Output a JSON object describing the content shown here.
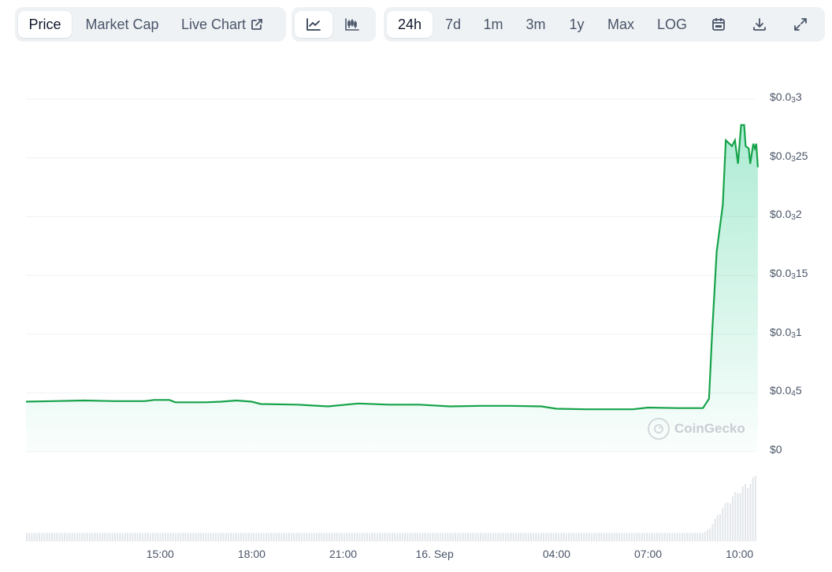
{
  "toolbar_left": {
    "price": "Price",
    "market_cap": "Market Cap",
    "live_chart": "Live Chart"
  },
  "toolbar_mid": {
    "line_icon": "line-chart-icon",
    "candle_icon": "candlestick-icon"
  },
  "toolbar_right": {
    "ranges": [
      "24h",
      "7d",
      "1m",
      "3m",
      "1y",
      "Max",
      "LOG"
    ],
    "selected": "24h",
    "icons": [
      "calendar-icon",
      "download-icon",
      "expand-icon"
    ]
  },
  "watermark": "CoinGecko",
  "colors": {
    "line": "#16a34a",
    "fill": "#16c784",
    "volume": "#e2e6ea",
    "grid": "#eef0f3"
  },
  "chart_data": {
    "type": "area",
    "y_ticks": [
      {
        "main": "$0.0",
        "sub": "3",
        "tail": "3"
      },
      {
        "main": "$0.0",
        "sub": "3",
        "tail": "25"
      },
      {
        "main": "$0.0",
        "sub": "3",
        "tail": "2"
      },
      {
        "main": "$0.0",
        "sub": "3",
        "tail": "15"
      },
      {
        "main": "$0.0",
        "sub": "3",
        "tail": "1"
      },
      {
        "main": "$0.0",
        "sub": "4",
        "tail": "5"
      },
      {
        "main": "$0",
        "sub": "",
        "tail": ""
      }
    ],
    "ylim": [
      0,
      0.0003
    ],
    "x_ticks": [
      "15:00",
      "18:00",
      "21:00",
      "16. Sep",
      "04:00",
      "07:00",
      "10:00"
    ],
    "x_tick_hours": [
      15,
      18,
      21,
      24,
      28,
      31,
      34
    ],
    "x_range_hours": [
      10.6,
      34.5
    ],
    "price_points": [
      [
        10.6,
        4.25e-05
      ],
      [
        11.5,
        4.3e-05
      ],
      [
        12.5,
        4.35e-05
      ],
      [
        13.5,
        4.3e-05
      ],
      [
        14.5,
        4.3e-05
      ],
      [
        14.8,
        4.4e-05
      ],
      [
        15.3,
        4.4e-05
      ],
      [
        15.5,
        4.2e-05
      ],
      [
        16.5,
        4.2e-05
      ],
      [
        17.0,
        4.25e-05
      ],
      [
        17.5,
        4.35e-05
      ],
      [
        18.0,
        4.25e-05
      ],
      [
        18.3,
        4.05e-05
      ],
      [
        19.5,
        4e-05
      ],
      [
        20.5,
        3.85e-05
      ],
      [
        21.5,
        4.1e-05
      ],
      [
        22.5,
        4e-05
      ],
      [
        23.5,
        4e-05
      ],
      [
        24.5,
        3.85e-05
      ],
      [
        25.5,
        3.9e-05
      ],
      [
        26.5,
        3.9e-05
      ],
      [
        27.5,
        3.85e-05
      ],
      [
        28.0,
        3.65e-05
      ],
      [
        29.0,
        3.6e-05
      ],
      [
        30.0,
        3.6e-05
      ],
      [
        30.5,
        3.6e-05
      ],
      [
        31.0,
        3.75e-05
      ],
      [
        32.0,
        3.7e-05
      ],
      [
        32.8,
        3.7e-05
      ],
      [
        33.0,
        4.5e-05
      ],
      [
        33.1,
        0.0001
      ],
      [
        33.25,
        0.00017
      ],
      [
        33.45,
        0.00021
      ],
      [
        33.55,
        0.000265
      ],
      [
        33.75,
        0.00026
      ],
      [
        33.85,
        0.000265
      ],
      [
        33.95,
        0.000245
      ],
      [
        34.05,
        0.000278
      ],
      [
        34.15,
        0.000278
      ],
      [
        34.2,
        0.00026
      ],
      [
        34.3,
        0.000258
      ],
      [
        34.35,
        0.000245
      ],
      [
        34.45,
        0.000262
      ],
      [
        34.5,
        0.000258
      ],
      [
        34.55,
        0.000262
      ],
      [
        34.6,
        0.000242
      ]
    ],
    "volume_points": [
      [
        10.6,
        0.12
      ],
      [
        14.5,
        0.12
      ],
      [
        18.0,
        0.12
      ],
      [
        24.0,
        0.12
      ],
      [
        28.0,
        0.12
      ],
      [
        31.0,
        0.12
      ],
      [
        32.8,
        0.12
      ],
      [
        33.0,
        0.2
      ],
      [
        33.2,
        0.35
      ],
      [
        33.4,
        0.5
      ],
      [
        33.6,
        0.6
      ],
      [
        33.8,
        0.7
      ],
      [
        34.0,
        0.78
      ],
      [
        34.2,
        0.85
      ],
      [
        34.4,
        0.92
      ],
      [
        34.5,
        0.98
      ],
      [
        34.6,
        0.95
      ]
    ]
  }
}
